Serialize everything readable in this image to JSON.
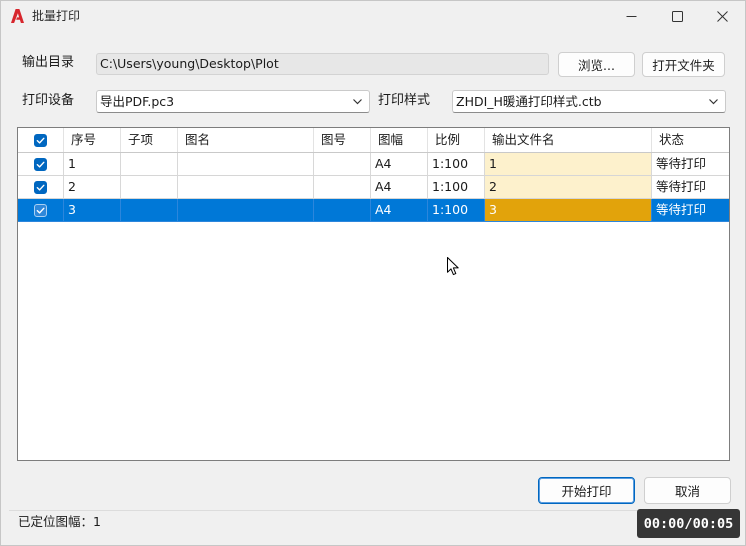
{
  "title_bar": {
    "title": "批量打印",
    "logo_icon": "autocad-logo-icon",
    "minimize_icon": "minimize-icon",
    "maximize_icon": "maximize-icon",
    "close_icon": "close-icon"
  },
  "output_dir": {
    "label": "输出目录",
    "value": "C:\\Users\\young\\Desktop\\Plot",
    "browse_label": "浏览...",
    "open_folder_label": "打开文件夹"
  },
  "device": {
    "label": "打印设备",
    "value": "导出PDF.pc3",
    "dropdown_icon": "chevron-down-icon"
  },
  "plot_style": {
    "label": "打印样式",
    "value": "ZHDI_H暖通打印样式.ctb",
    "dropdown_icon": "chevron-down-icon"
  },
  "table": {
    "select_all_checked": true,
    "columns": [
      "序号",
      "子项",
      "图名",
      "图号",
      "图幅",
      "比例",
      "输出文件名",
      "状态"
    ],
    "rows": [
      {
        "checked": true,
        "selected": false,
        "cells": [
          "1",
          "",
          "",
          "",
          "A4",
          "1:100",
          "1",
          "等待打印"
        ]
      },
      {
        "checked": true,
        "selected": false,
        "cells": [
          "2",
          "",
          "",
          "",
          "A4",
          "1:100",
          "2",
          "等待打印"
        ]
      },
      {
        "checked": true,
        "selected": true,
        "cells": [
          "3",
          "",
          "",
          "",
          "A4",
          "1:100",
          "3",
          "等待打印"
        ]
      }
    ]
  },
  "actions": {
    "start_label": "开始打印",
    "cancel_label": "取消"
  },
  "status": {
    "text": "已定位图幅：1"
  },
  "recording_timer": {
    "text": "00:00/00:05"
  },
  "colors": {
    "accent": "#0067c0",
    "selection": "#0078d7",
    "output_highlight": "#fdf1cc",
    "output_selected": "#e2a30b",
    "logo_red": "#d7262d"
  }
}
